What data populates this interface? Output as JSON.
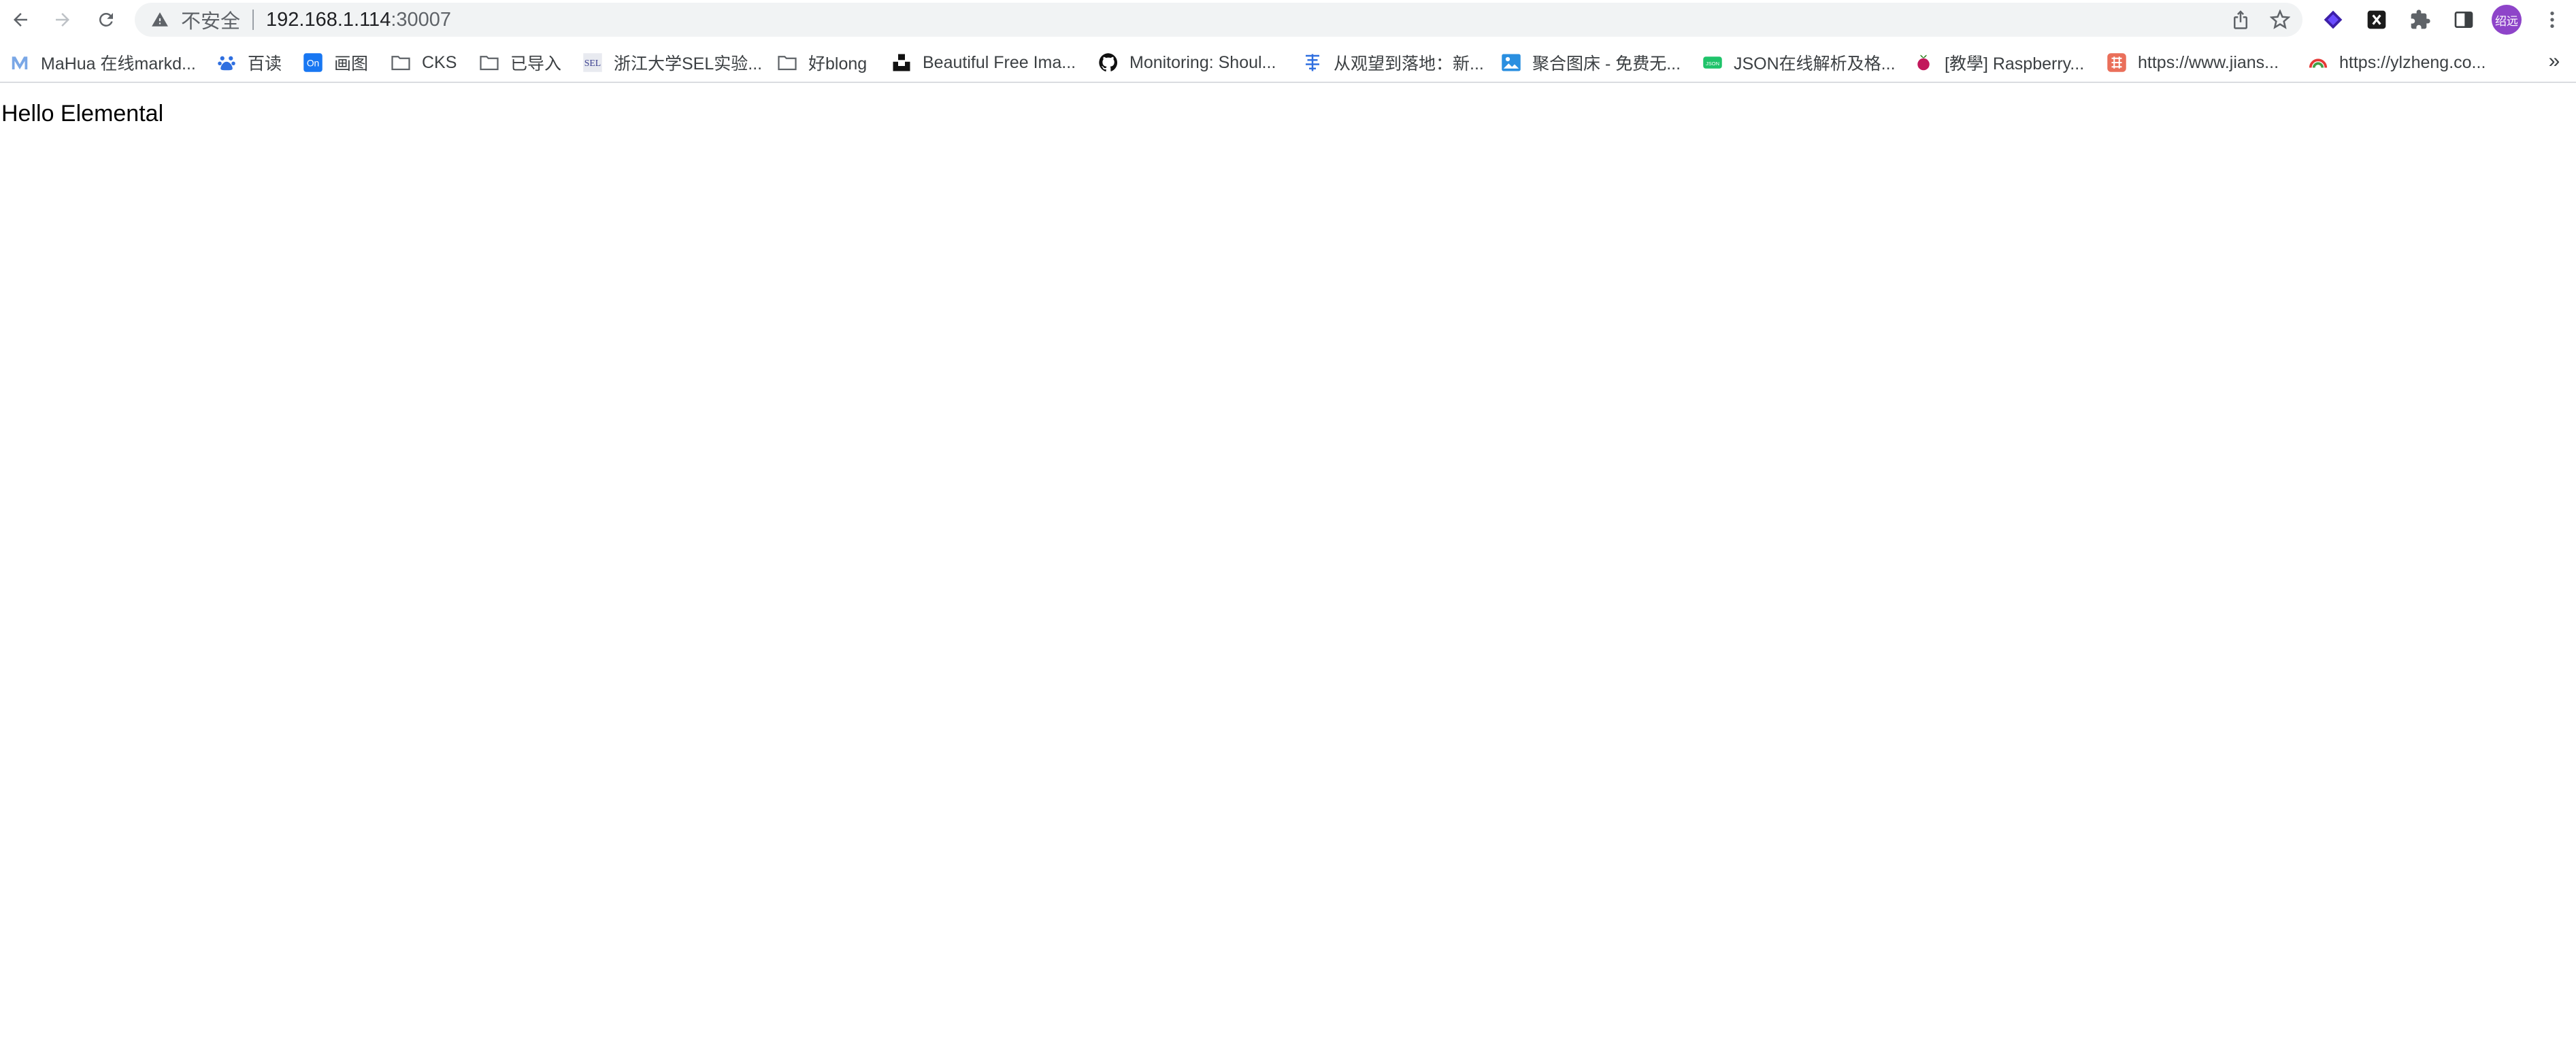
{
  "omnibox": {
    "security_label": "不安全",
    "host": "192.168.1.114",
    "port": ":30007"
  },
  "profile": {
    "initials": "绍远"
  },
  "bookmarks": [
    {
      "label": "MaHua 在线markd..."
    },
    {
      "label": "百读"
    },
    {
      "label": "画图"
    },
    {
      "label": "CKS"
    },
    {
      "label": "已导入"
    },
    {
      "label": "浙江大学SEL实验..."
    },
    {
      "label": "好blong"
    },
    {
      "label": "Beautiful Free Ima..."
    },
    {
      "label": "Monitoring: Shoul..."
    },
    {
      "label": "从观望到落地：新..."
    },
    {
      "label": "聚合图床 - 免费无..."
    },
    {
      "label": "JSON在线解析及格..."
    },
    {
      "label": "[教學] Raspberry..."
    },
    {
      "label": "https://www.jians..."
    },
    {
      "label": "https://ylzheng.co..."
    }
  ],
  "bookmarks_overflow": "»",
  "page": {
    "text": "Hello Elemental"
  },
  "colors": {
    "accent": "#1a73e8",
    "avatar": "#8e44c9"
  }
}
